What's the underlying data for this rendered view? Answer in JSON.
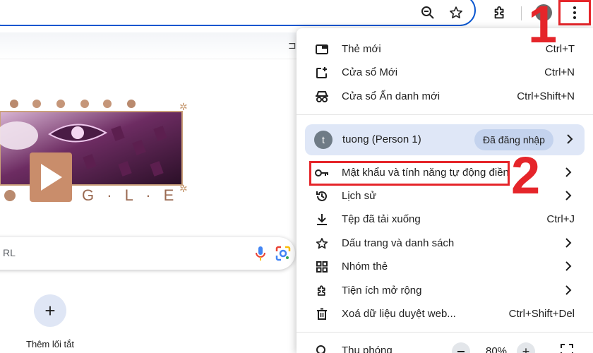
{
  "annotations": {
    "step_1": "1",
    "step_2": "2"
  },
  "page": {
    "search_partial": "RL",
    "shortcut_add_symbol": "+",
    "shortcut_label": "Thêm lối tắt",
    "doodle_letters": "G · L · E"
  },
  "menu": {
    "new_tab": {
      "label": "Thẻ mới",
      "shortcut": "Ctrl+T"
    },
    "new_window": {
      "label": "Cửa sổ Mới",
      "shortcut": "Ctrl+N"
    },
    "incognito": {
      "label": "Cửa sổ Ẩn danh mới",
      "shortcut": "Ctrl+Shift+N"
    },
    "profile": {
      "avatar_letter": "t",
      "name": "tuong (Person 1)",
      "status": "Đã đăng nhập"
    },
    "passwords": {
      "label": "Mật khẩu và tính năng tự động điền"
    },
    "history": {
      "label": "Lịch sử"
    },
    "downloads": {
      "label": "Tệp đã tải xuống",
      "shortcut": "Ctrl+J"
    },
    "bookmarks": {
      "label": "Dấu trang và danh sách"
    },
    "tab_groups": {
      "label": "Nhóm thẻ"
    },
    "extensions": {
      "label": "Tiện ích mở rộng"
    },
    "clear_data": {
      "label": "Xoá dữ liệu duyệt web...",
      "shortcut": "Ctrl+Shift+Del"
    },
    "zoom": {
      "label": "Thu phóng",
      "value": "80%"
    }
  },
  "colors": {
    "accent": "#0b57d0",
    "annotation_red": "#e5252a",
    "profile_bg": "#dfe7f7"
  }
}
